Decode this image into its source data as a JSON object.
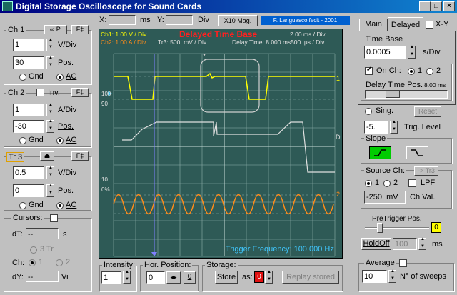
{
  "window": {
    "title": "Digital Storage Oscilloscope for Sound Cards",
    "btn_min": "_",
    "btn_max": "□",
    "btn_close": "×"
  },
  "top": {
    "x_label": "X:",
    "x_unit": "ms",
    "y_label": "Y:",
    "y_unit": "Div",
    "mag_button": "X10 Mag.",
    "author": "F. Languasco fecit - 2001"
  },
  "ch1": {
    "label": "Ch 1",
    "ico_btn": "∞ P.",
    "f_btn": "F‡",
    "vdiv": "1",
    "vdiv_unit": "V/Div",
    "pos": "30",
    "pos_label": "Pos.",
    "gnd": "Gnd",
    "ac": "AC"
  },
  "ch2": {
    "label": "Ch 2",
    "inv": "Inv.",
    "f_btn": "F‡",
    "adiv": "1",
    "adiv_unit": "A/Div",
    "pos": "-30",
    "pos_label": "Pos.",
    "gnd": "Gnd",
    "ac": "AC"
  },
  "tr3": {
    "label": "Tr 3",
    "eject": "⏏",
    "f_btn": "F‡",
    "vdiv": "0.5",
    "vdiv_unit": "V/Div",
    "pos": "0",
    "pos_label": "Pos.",
    "gnd": "Gnd",
    "ac": "AC"
  },
  "cursors": {
    "label": "Cursors:",
    "dt_label": "dT:",
    "dt_val": "--",
    "dt_unit": "s",
    "tr3": "3 Tr",
    "ch_label": "Ch:",
    "ch1": "1",
    "ch2": "2",
    "dy_label": "dY:",
    "dy_val": "--",
    "dy_unit": "Vi"
  },
  "scope": {
    "ch1_info": "Ch1: 1.00 V / Div",
    "ch2_info": "Ch2: 1.00 A / Div",
    "tr3_info": "Tr3: 500. mV / Div",
    "title": "Delayed Time Base",
    "tb_top": "2.00 ms / Div",
    "delay_time": "Delay Time: 8.000 ms",
    "tb_bottom": "500. μs / Div",
    "trigger": "Trigger Frequency: 100.000 Hz",
    "lbl_100": "100",
    "lbl_90": "90",
    "lbl_10": "10",
    "lbl_0": "0%",
    "mark1": "1",
    "markD": "D",
    "mark2": "2"
  },
  "tabs": {
    "main": "Main",
    "delayed": "Delayed",
    "xy": "X-Y"
  },
  "delayed": {
    "timebase_label": "Time Base",
    "timebase_val": "0.0005",
    "timebase_unit": "s/Div",
    "onch_label": "On Ch:",
    "onch1": "1",
    "onch2": "2",
    "delay_pos_label": "Delay Time Pos.",
    "delay_pos_val": "8.00 ms"
  },
  "trigger": {
    "sing": "Sing.",
    "reset": "Reset",
    "level_val": "-5.",
    "level_label": "Trig. Level",
    "slope_label": "Slope",
    "source_label": "Source Ch:",
    "tr3_btn": "-> Tr3",
    "src1": "1",
    "src2": "2",
    "lpf": "LPF",
    "chval_val": "-250. mV",
    "chval_label": "Ch Val."
  },
  "pretrigger": {
    "label": "PreTrigger Pos.",
    "val": "0",
    "holdoff_btn": "HoldOff",
    "holdoff_val": "100",
    "holdoff_unit": "ms"
  },
  "bottom": {
    "intensity_label": "Intensity:",
    "intensity_val": "1",
    "hpos_label": "Hor. Position:",
    "hpos_val": "0",
    "hpos_reset": "0",
    "storage_label": "Storage:",
    "store_btn": "Store",
    "as_label": "as:",
    "as_val": "0",
    "replay_btn": "Replay stored",
    "average_label": "Average",
    "average_val": "10",
    "sweeps_label": "N° of sweeps"
  },
  "colors": {
    "screen": "#2e5a56",
    "ch1": "#ffff00",
    "ch2": "#ff8c1a",
    "trace3": "#e0e0e0",
    "title_red": "#ff2020",
    "trigger_text": "#40c8ff"
  }
}
